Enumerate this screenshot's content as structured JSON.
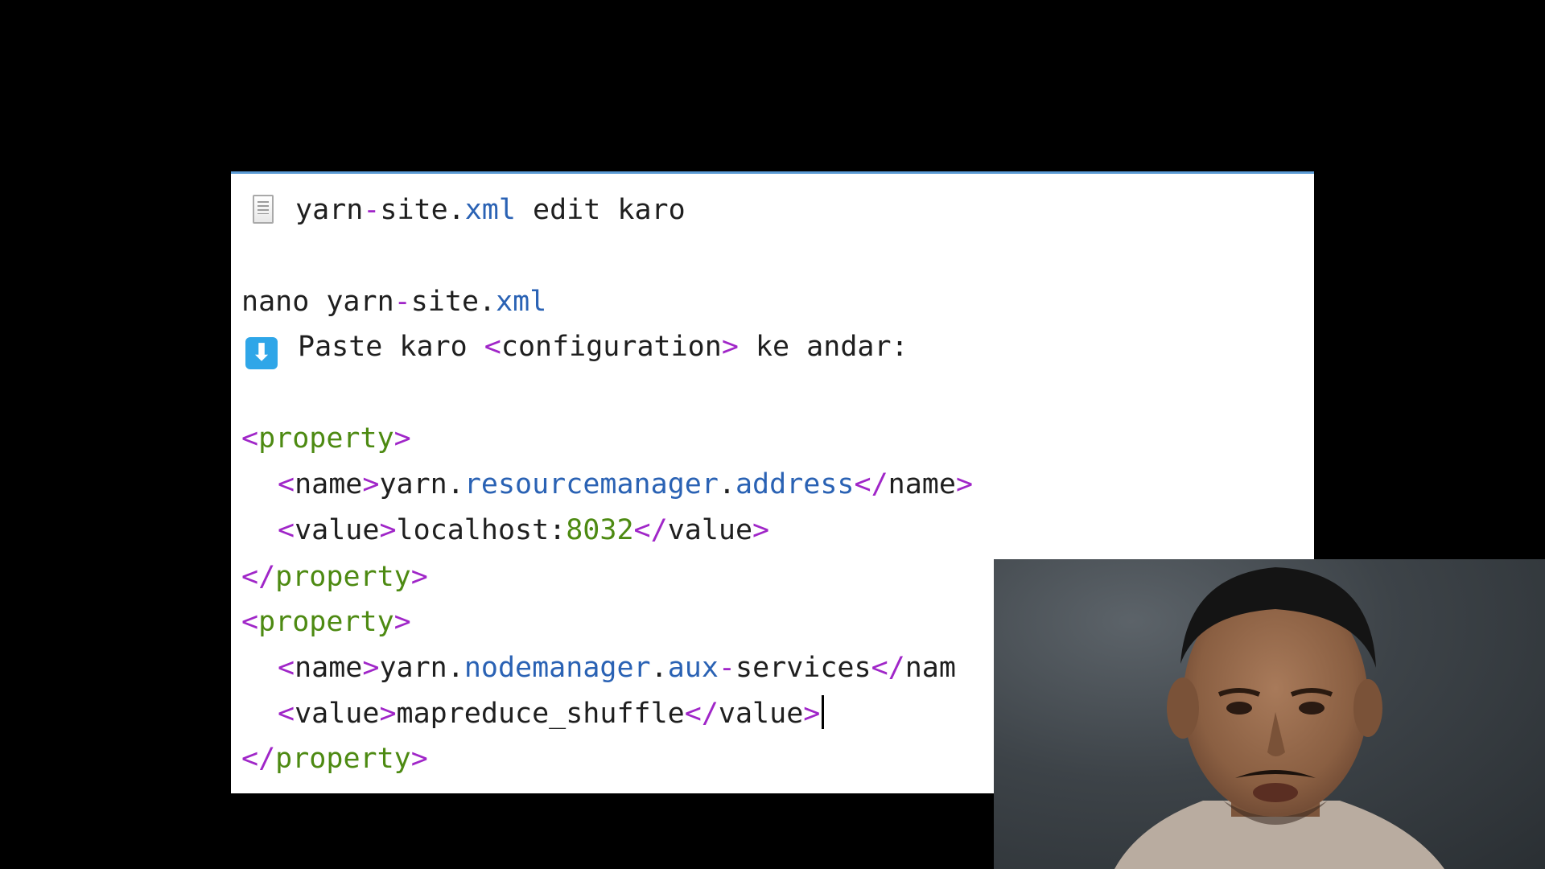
{
  "editor": {
    "heading": {
      "icon": "document-icon",
      "file_base": "yarn",
      "file_dash": "-",
      "file_mid": "site.",
      "file_ext": "xml",
      "rest": " edit karo"
    },
    "command": {
      "cmd": "nano ",
      "file_base": "yarn",
      "file_dash": "-",
      "file_mid": "site.",
      "file_ext": "xml"
    },
    "instruction": {
      "icon": "down-arrow-icon",
      "icon_glyph": "⬇",
      "pre": "Paste karo ",
      "tag_open": "<",
      "tag_name": "configuration",
      "tag_close": ">",
      "post": " ke andar:"
    },
    "xml": {
      "lt": "<",
      "gt": ">",
      "lt_slash": "</",
      "property": "property",
      "name_tag": "name",
      "value_tag": "value",
      "name1_a": "yarn",
      "dot": ".",
      "name1_b": "resourcemanager",
      "name1_c": "address",
      "value1_a": "localhost:",
      "value1_b": "8032",
      "name2_a": "yarn",
      "name2_b": "nodemanager",
      "name2_c": "aux",
      "dash": "-",
      "name2_d": "services",
      "name2_close_partial": "nam",
      "value2": "mapreduce_shuffle"
    },
    "colors": {
      "tag": "#a026c8",
      "property": "#4d8a12",
      "identifier": "#2a62b4",
      "number": "#4d8a12",
      "text": "#1f1f1f"
    }
  },
  "webcam": {
    "subject": "presenter-webcam-feed"
  }
}
